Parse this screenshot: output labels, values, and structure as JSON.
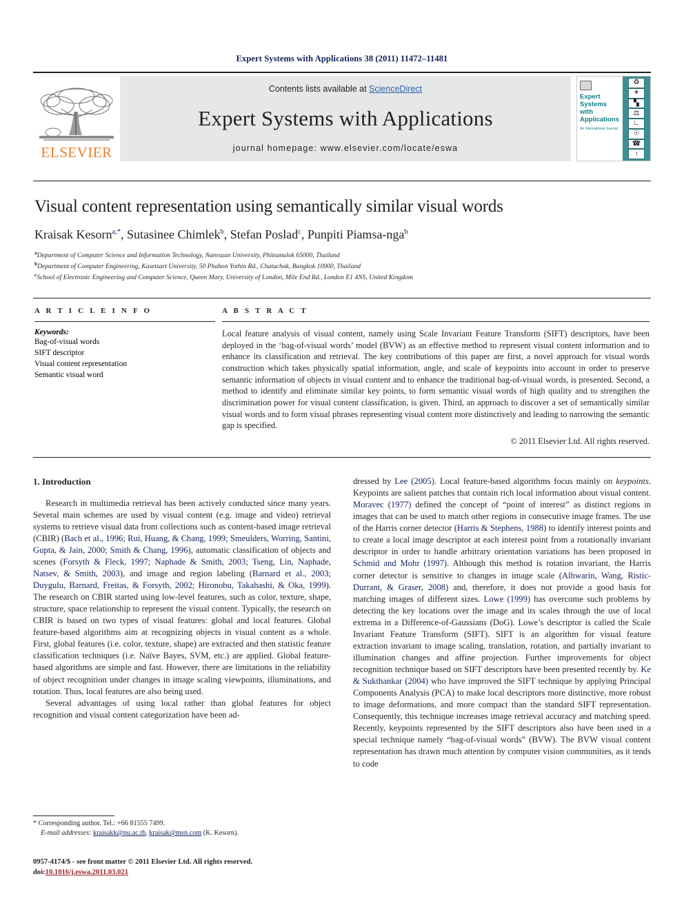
{
  "running_head": "Expert Systems with Applications 38 (2011) 11472–11481",
  "header": {
    "publisher": "ELSEVIER",
    "contents_prefix": "Contents lists available at ",
    "contents_link": "ScienceDirect",
    "journal_title": "Expert Systems with Applications",
    "homepage": "journal homepage: www.elsevier.com/locate/eswa",
    "cover": {
      "title_lines": [
        "Expert",
        "Systems",
        "with",
        "Applications"
      ],
      "subtitle": "An International Journal",
      "icons": [
        "recycle-icon",
        "globe-icon",
        "chart-icon",
        "scales-icon",
        "microscope-icon",
        "satellite-icon",
        "telephone-icon",
        "rocket-icon"
      ]
    }
  },
  "article": {
    "title": "Visual content representation using semantically similar visual words",
    "authors": [
      {
        "name": "Kraisak Kesorn",
        "marks": "a,*"
      },
      {
        "name": "Sutasinee Chimlek",
        "marks": "b"
      },
      {
        "name": "Stefan Poslad",
        "marks": "c"
      },
      {
        "name": "Punpiti Piamsa-nga",
        "marks": "b"
      }
    ],
    "affiliations": [
      {
        "mark": "a",
        "text": "Department of Computer Science and Information Technology, Naresuan University, Phitsanulok 65000, Thailand"
      },
      {
        "mark": "b",
        "text": "Department of Computer Engineering, Kasetsart University, 50 Phahon Yothin Rd., Chatuchak, Bangkok 10900, Thailand"
      },
      {
        "mark": "c",
        "text": "School of Electronic Engineering and Computer Science, Queen Mary, University of London, Mile End Rd., London E1 4NS, United Kingdom"
      }
    ]
  },
  "article_info": {
    "heading": "A R T I C L E  I N F O",
    "keywords_label": "Keywords:",
    "keywords": [
      "Bag-of-visual words",
      "SIFT descriptor",
      "Visual content representation",
      "Semantic visual word"
    ]
  },
  "abstract": {
    "heading": "A B S T R A C T",
    "text": "Local feature analysis of visual content, namely using Scale Invariant Feature Transform (SIFT) descriptors, have been deployed in the ‘bag-of-visual words’ model (BVW) as an effective method to represent visual content information and to enhance its classification and retrieval. The key contributions of this paper are first, a novel approach for visual words construction which takes physically spatial information, angle, and scale of keypoints into account in order to preserve semantic information of objects in visual content and to enhance the traditional bag-of-visual words, is presented. Second, a method to identify and eliminate similar key points, to form semantic visual words of high quality and to strengthen the discrimination power for visual content classification, is given. Third, an approach to discover a set of semantically similar visual words and to form visual phrases representing visual content more distinctively and leading to narrowing the semantic gap is specified.",
    "copyright": "© 2011 Elsevier Ltd. All rights reserved."
  },
  "intro": {
    "section_title": "1. Introduction",
    "left_para1_pre": "Research in multimedia retrieval has been actively conducted since many years. Several main schemes are used by visual content (e.g. image and video) retrieval systems to retrieve visual data from collections such as content-based image retrieval (CBIR) (",
    "left_ref1": "Bach et al., 1996; Rui, Huang, & Chang, 1999; Smeulders, Worring, Santini, Gupta, & Jain, 2000; Smith & Chang, 1996",
    "left_mid1": "), automatic classification of objects and scenes (",
    "left_ref2": "Forsyth & Fleck, 1997; Naphade & Smith, 2003; Tseng, Lin, Naphade, Natsev, & Smith, 2003",
    "left_mid2": "), and image and region labeling (",
    "left_ref3": "Barnard et al., 2003; Duygulu, Barnard, Freitas, & Forsyth, 2002; Hironobu, Takahashi, & Oka, 1999",
    "left_post": "). The research on CBIR started using low-level features, such as color, texture, shape, structure, space relationship to represent the visual content. Typically, the research on CBIR is based on two types of visual features: global and local features. Global feature-based algorithms aim at recognizing objects in visual content as a whole. First, global features (i.e. color, texture, shape) are extracted and then statistic feature classification techniques (i.e. Naïve Bayes, SVM, etc.) are applied. Global feature-based algorithms are simple and fast. However, there are limitations in the reliability of object recognition under changes in image scaling viewpoints, illuminations, and rotation. Thus, local features are also being used.",
    "left_para2": "Several advantages of using local rather than global features for object recognition and visual content categorization have been ad-",
    "right_pre1": "dressed by ",
    "right_ref1": "Lee (2005)",
    "right_mid1": ". Local feature-based algorithms focus mainly on ",
    "right_italic1": "keypoints",
    "right_mid2": ". Keypoints are salient patches that contain rich local information about visual content. ",
    "right_ref2": "Moravec (1977)",
    "right_mid3": " defined the concept of “point of interest” as distinct regions in images that can be used to match other regions in consecutive image frames. The use of the Harris corner detector (",
    "right_ref3": "Harris & Stephens, 1988",
    "right_mid4": ") to identify interest points and to create a local image descriptor at each interest point from a rotationally invariant descriptor in order to handle arbitrary orientation variations has been proposed in ",
    "right_ref4": "Schmid and Mohr (1997)",
    "right_mid5": ". Although this method is rotation invariant, the Harris corner detector is sensitive to changes in image scale (",
    "right_ref5": "Alhwarin, Wang, Ristic-Durrant, & Graser, 2008",
    "right_mid6": ") and, therefore, it does not provide a good basis for matching images of different sizes. ",
    "right_ref6": "Lowe (1999)",
    "right_mid7": " has overcome such problems by detecting the key locations over the image and its scales through the use of local extrema in a Difference-of-Gaussians (DoG). Lowe’s descriptor is called the Scale Invariant Feature Transform (SIFT). SIFT is an algorithm for visual feature extraction invariant to image scaling, translation, rotation, and partially invariant to illumination changes and affine projection. Further improvements for object recognition technique based on SIFT descriptors have been presented recently by. ",
    "right_ref7": "Ke & Sukthankar (2004)",
    "right_post": " who have improved the SIFT technique by applying Principal Components Analysis (PCA) to make local descriptors more distinctive, more robust to image deformations, and more compact than the standard SIFT representation. Consequently, this technique increases image retrieval accuracy and matching speed. Recently, keypoints represented by the SIFT descriptors also have been used in a special technique namely “bag-of-visual words” (BVW). The BVW visual content representation has drawn much attention by computer vision communities, as it tends to code"
  },
  "footnote": {
    "corresponding": "* Corresponding author. Tel.: +66 81555 7499.",
    "email_label": "E-mail addresses:",
    "email1": "kraisakk@nu.ac.th",
    "email_sep": ", ",
    "email2": "kraisak@msn.com",
    "email_suffix": " (K. Kesorn)."
  },
  "issn": {
    "line1": "0957-4174/$ - see front matter © 2011 Elsevier Ltd. All rights reserved.",
    "doi_label": "doi:",
    "doi_value": "10.1016/j.eswa.2011.03.021"
  }
}
